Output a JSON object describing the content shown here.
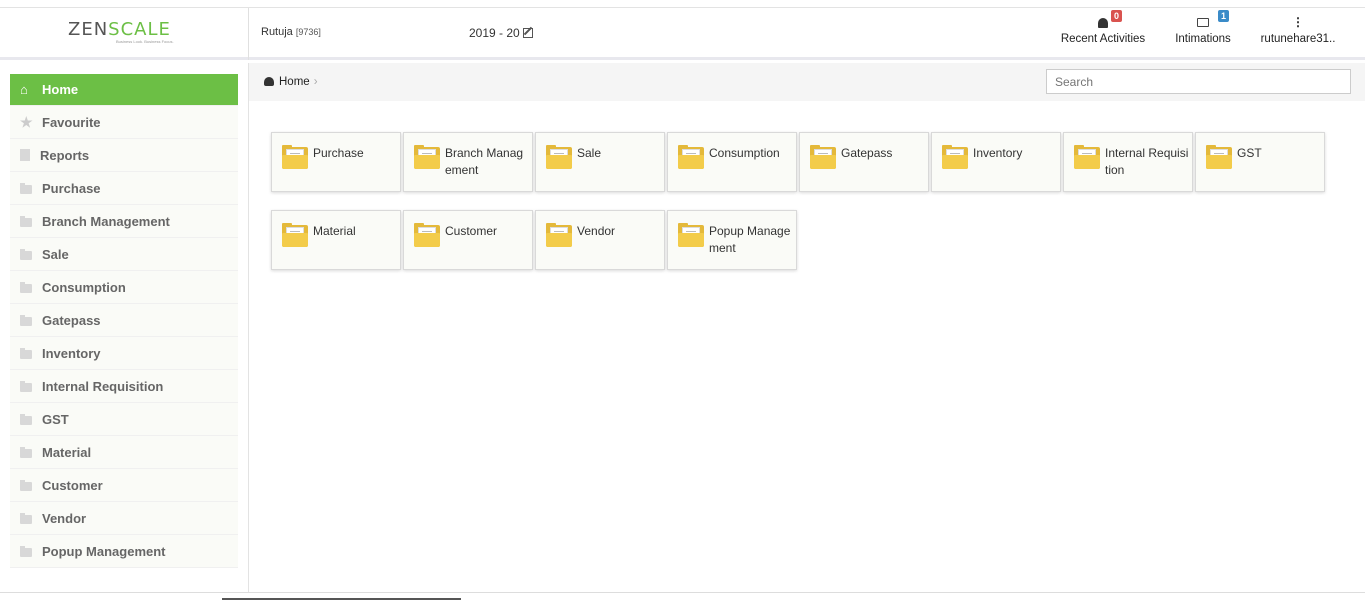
{
  "header": {
    "logo_text_1": "ZEN",
    "logo_text_2": "SCALE",
    "logo_tagline": "Business Look. Business Focus.",
    "user_name": "Rutuja",
    "user_code": "[9736]",
    "fiscal_year": "2019 - 20",
    "recent_activities_label": "Recent Activities",
    "recent_activities_count": "0",
    "intimations_label": "Intimations",
    "intimations_count": "1",
    "account_label": "rutunehare31..",
    "more_glyph": "⋮",
    "colors": {
      "accent": "#6cbf45",
      "badge_red": "#d9534f",
      "badge_blue": "#3a8bc8"
    }
  },
  "sidebar": {
    "items": [
      {
        "label": "Home",
        "icon": "home-icon",
        "active": true
      },
      {
        "label": "Favourite",
        "icon": "star-icon"
      },
      {
        "label": "Reports",
        "icon": "document-icon"
      },
      {
        "label": "Purchase",
        "icon": "folder-icon"
      },
      {
        "label": "Branch Management",
        "icon": "folder-icon"
      },
      {
        "label": "Sale",
        "icon": "folder-icon"
      },
      {
        "label": "Consumption",
        "icon": "folder-icon"
      },
      {
        "label": "Gatepass",
        "icon": "folder-icon"
      },
      {
        "label": "Inventory",
        "icon": "folder-icon"
      },
      {
        "label": "Internal Requisition",
        "icon": "folder-icon"
      },
      {
        "label": "GST",
        "icon": "folder-icon"
      },
      {
        "label": "Material",
        "icon": "folder-icon"
      },
      {
        "label": "Customer",
        "icon": "folder-icon"
      },
      {
        "label": "Vendor",
        "icon": "folder-icon"
      },
      {
        "label": "Popup Management",
        "icon": "folder-icon"
      }
    ]
  },
  "breadcrumb": {
    "home_label": "Home",
    "separator": "›"
  },
  "search": {
    "placeholder": "Search"
  },
  "tiles": [
    {
      "label": "Purchase"
    },
    {
      "label": "Branch Management"
    },
    {
      "label": "Sale"
    },
    {
      "label": "Consumption"
    },
    {
      "label": "Gatepass"
    },
    {
      "label": "Inventory"
    },
    {
      "label": "Internal Requisition"
    },
    {
      "label": "GST"
    },
    {
      "label": "Material"
    },
    {
      "label": "Customer"
    },
    {
      "label": "Vendor"
    },
    {
      "label": "Popup Management"
    }
  ]
}
